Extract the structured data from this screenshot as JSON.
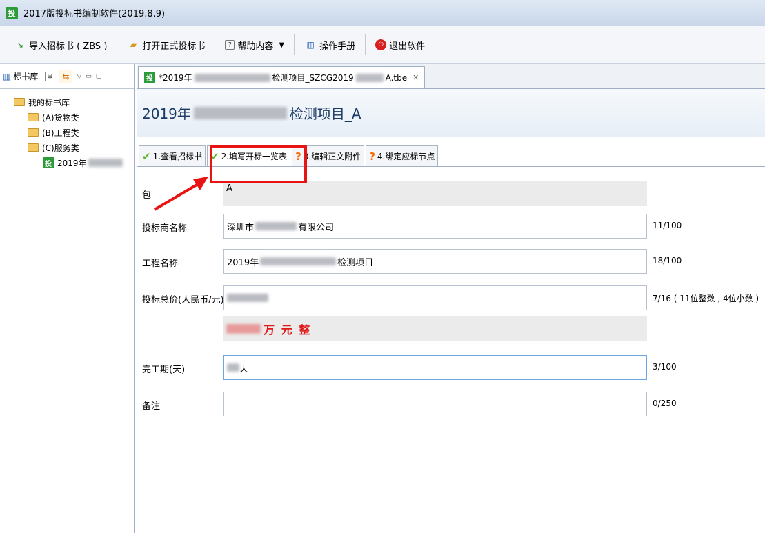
{
  "window": {
    "title": "2017版投标书编制软件(2019.8.9)",
    "app_icon": "投"
  },
  "toolbar": {
    "import_label": "导入招标书 ( ZBS )",
    "open_label": "打开正式投标书",
    "help_label": "帮助内容",
    "manual_label": "操作手册",
    "exit_label": "退出软件"
  },
  "left_panel": {
    "tab_label": "标书库",
    "tree": {
      "root": "我的标书库",
      "items": [
        "(A)货物类",
        "(B)工程类",
        "(C)服务类"
      ],
      "leaf_prefix": "2019年",
      "leaf_icon": "投"
    }
  },
  "editor": {
    "tab_title_a": "*2019年",
    "tab_title_b": "检测项目_SZCG2019",
    "tab_title_c": "A.tbe",
    "heading_prefix": "2019年",
    "heading_suffix": "检测项目_A",
    "steps": [
      {
        "label": "1.查看招标书",
        "status": "done"
      },
      {
        "label": "2.填写开标一览表",
        "status": "done",
        "selected": true
      },
      {
        "label": "3.编辑正文附件",
        "status": "todo"
      },
      {
        "label": "4.绑定应标节点",
        "status": "todo"
      }
    ]
  },
  "form": {
    "package": {
      "label": "包",
      "value": "A"
    },
    "bidder": {
      "label": "投标商名称",
      "value_a": "深圳市",
      "value_b": "有限公司",
      "counter": "11/100"
    },
    "project": {
      "label": "工程名称",
      "value_a": "2019年",
      "value_b": "检测项目",
      "counter": "18/100"
    },
    "price": {
      "label": "投标总价(人民币/元)",
      "counter": "7/16 ( 11位整数 , 4位小数 )"
    },
    "price_words": {
      "value": "万 元 整"
    },
    "duration": {
      "label": "完工期(天)",
      "value": "天",
      "counter": "3/100"
    },
    "remarks": {
      "label": "备注",
      "value": "",
      "counter": "0/250"
    }
  },
  "colors": {
    "highlight": "#e81414",
    "check": "#5cb82f",
    "warning": "#ff6a00",
    "amount_text": "#e01818"
  }
}
